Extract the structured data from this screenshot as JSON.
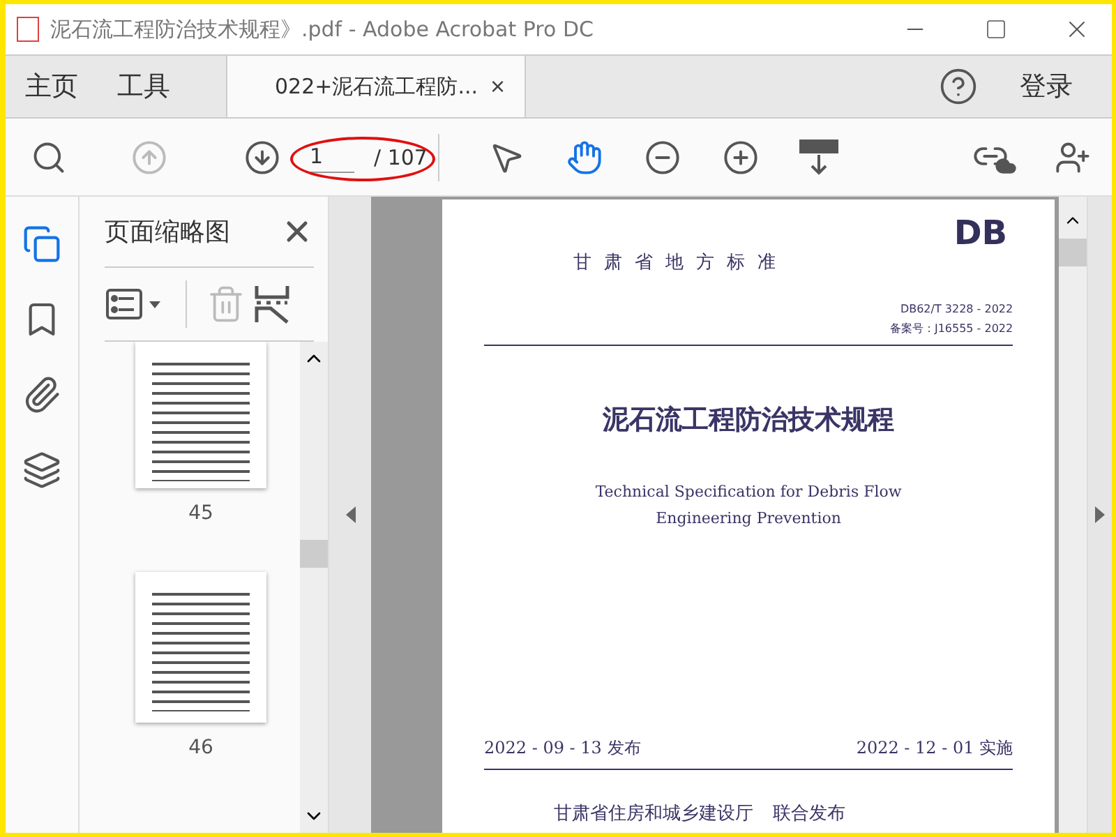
{
  "window": {
    "title": "泥石流工程防治技术规程》.pdf - Adobe Acrobat Pro DC"
  },
  "nav_tabs": [
    {
      "label": "主页",
      "selected": false
    },
    {
      "label": "工具",
      "selected": false
    }
  ],
  "document_tab": {
    "label": "022+泥石流工程防...",
    "close": "×",
    "selected": true
  },
  "login": "登录",
  "toolbar": {
    "tools": [
      {
        "kind": "find",
        "disabled": false,
        "selected": false
      },
      {
        "kind": "prev",
        "disabled": true,
        "selected": false
      },
      {
        "kind": "next",
        "disabled": false,
        "selected": false
      },
      {
        "kind": "page"
      },
      {
        "kind": "pointer",
        "disabled": false,
        "selected": false
      },
      {
        "kind": "hand",
        "disabled": false,
        "selected": true
      },
      {
        "kind": "zoom-out",
        "disabled": false,
        "selected": false
      },
      {
        "kind": "zoom-in",
        "disabled": false,
        "selected": false
      },
      {
        "kind": "scroll",
        "disabled": false,
        "selected": false
      },
      {
        "kind": "spacer"
      },
      {
        "kind": "share-link",
        "disabled": false,
        "selected": false
      },
      {
        "kind": "add-user",
        "disabled": false,
        "selected": false
      }
    ],
    "page_number": "1",
    "page_total": "/ 107",
    "page_circled": true
  },
  "sidebar": {
    "items": [
      {
        "kind": "pages",
        "selected": true
      },
      {
        "kind": "bookmarks",
        "selected": false
      },
      {
        "kind": "attachments",
        "selected": false
      },
      {
        "kind": "layers",
        "selected": false
      }
    ]
  },
  "thumbnails_panel": {
    "title": "页面缩略图",
    "delete_disabled": true,
    "pages": [
      {
        "label": "45",
        "selected": false,
        "cut": true
      },
      {
        "label": "46",
        "selected": false,
        "cut": false
      }
    ]
  },
  "document": {
    "badge": "DB",
    "authority": "甘肃省地方标准",
    "codes": [
      "DB62/T 3228 - 2022",
      "备案号：J16555 - 2022"
    ],
    "title_zh": "泥石流工程防治技术规程",
    "title_en": [
      "Technical Specification for Debris Flow",
      "Engineering Prevention"
    ],
    "issued": "2022 - 09 - 13 发布",
    "effective": "2022 - 12 - 01 实施",
    "issuers": [
      "甘肃省住房和城乡建设厅"
    ],
    "joint": "联合发布"
  }
}
